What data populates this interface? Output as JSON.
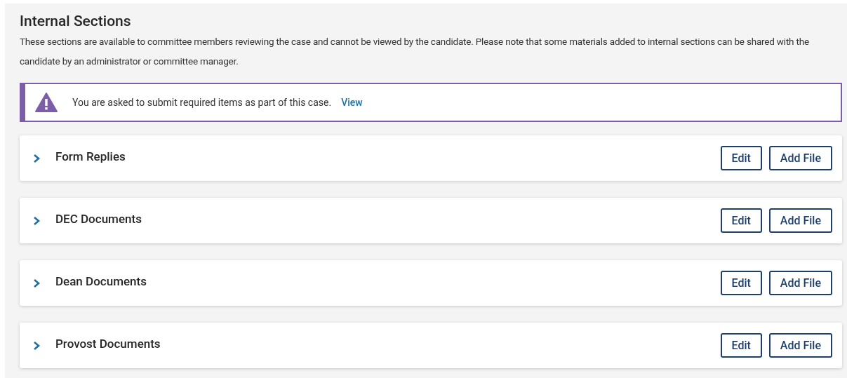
{
  "title": "Internal Sections",
  "description": "These sections are available to committee members reviewing the case and cannot be viewed by the candidate. Please note that some materials added to internal sections can be shared with the candidate by an administrator or committee manager.",
  "alert": {
    "message": "You are asked to submit required items as part of this case.",
    "link": "View"
  },
  "sections": [
    {
      "title": "Form Replies",
      "expanded": false,
      "buttons": [
        "Edit",
        "Add File"
      ]
    },
    {
      "title": "DEC Documents",
      "expanded": false,
      "buttons": [
        "Edit",
        "Add File"
      ]
    },
    {
      "title": "Dean Documents",
      "expanded": false,
      "buttons": [
        "Edit",
        "Add File"
      ]
    },
    {
      "title": "Provost Documents",
      "expanded": false,
      "buttons": [
        "Edit",
        "Add File"
      ]
    }
  ]
}
